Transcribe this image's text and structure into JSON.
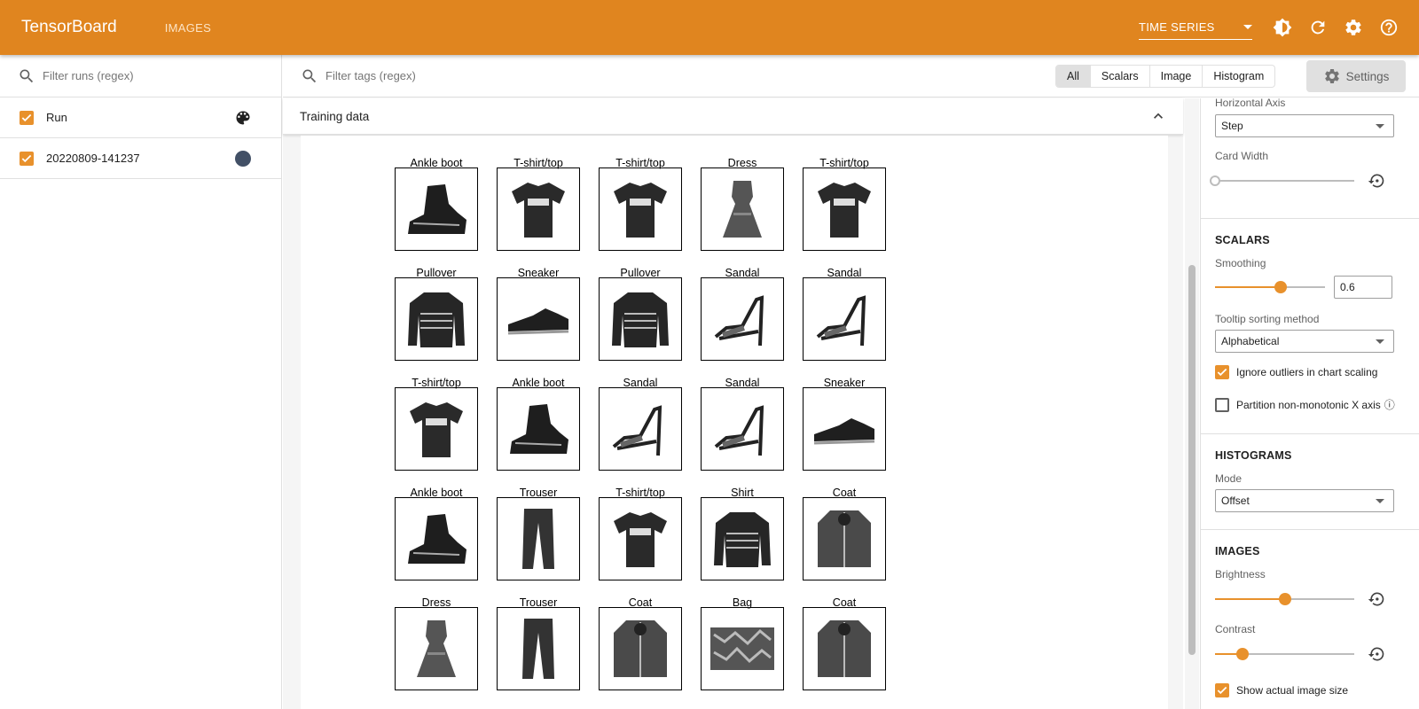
{
  "app": {
    "title": "TensorBoard",
    "nav_label": "IMAGES",
    "mode_selector": "TIME SERIES"
  },
  "runs": {
    "filter_placeholder": "Filter runs (regex)",
    "header_label": "Run",
    "items": [
      {
        "label": "20220809-141237",
        "color": "#425066",
        "checked": true
      }
    ]
  },
  "main": {
    "filter_placeholder": "Filter tags (regex)",
    "type_filters": [
      "All",
      "Scalars",
      "Image",
      "Histogram"
    ],
    "active_filter": "All",
    "settings_button": "Settings"
  },
  "card": {
    "title": "Training data",
    "images": [
      {
        "label": "Ankle boot",
        "icon": "boot-icon"
      },
      {
        "label": "T-shirt/top",
        "icon": "tshirt-icon"
      },
      {
        "label": "T-shirt/top",
        "icon": "tshirt-icon"
      },
      {
        "label": "Dress",
        "icon": "dress-icon"
      },
      {
        "label": "T-shirt/top",
        "icon": "tshirt-icon"
      },
      {
        "label": "Pullover",
        "icon": "pullover-icon"
      },
      {
        "label": "Sneaker",
        "icon": "sneaker-icon"
      },
      {
        "label": "Pullover",
        "icon": "pullover-icon"
      },
      {
        "label": "Sandal",
        "icon": "sandal-icon"
      },
      {
        "label": "Sandal",
        "icon": "sandal-icon"
      },
      {
        "label": "T-shirt/top",
        "icon": "tshirt-icon"
      },
      {
        "label": "Ankle boot",
        "icon": "boot-icon"
      },
      {
        "label": "Sandal",
        "icon": "sandal-icon"
      },
      {
        "label": "Sandal",
        "icon": "sandal-icon"
      },
      {
        "label": "Sneaker",
        "icon": "sneaker-icon"
      },
      {
        "label": "Ankle boot",
        "icon": "boot-icon"
      },
      {
        "label": "Trouser",
        "icon": "trouser-icon"
      },
      {
        "label": "T-shirt/top",
        "icon": "tshirt-icon"
      },
      {
        "label": "Shirt",
        "icon": "pullover-icon"
      },
      {
        "label": "Coat",
        "icon": "coat-icon"
      },
      {
        "label": "Dress",
        "icon": "dress-icon"
      },
      {
        "label": "Trouser",
        "icon": "trouser-icon"
      },
      {
        "label": "Coat",
        "icon": "coat-icon"
      },
      {
        "label": "Bag",
        "icon": "bag-icon"
      },
      {
        "label": "Coat",
        "icon": "coat-icon"
      }
    ]
  },
  "settings": {
    "general": {
      "horizontal_axis_label": "Horizontal Axis",
      "horizontal_axis_value": "Step",
      "card_width_label": "Card Width",
      "card_width_level": 0
    },
    "scalars": {
      "title": "SCALARS",
      "smoothing_label": "Smoothing",
      "smoothing_value": "0.6",
      "smoothing_level": 0.6,
      "tooltip_label": "Tooltip sorting method",
      "tooltip_value": "Alphabetical",
      "ignore_outliers_label": "Ignore outliers in chart scaling",
      "ignore_outliers": true,
      "partition_label": "Partition non-monotonic X axis",
      "partition": false
    },
    "histograms": {
      "title": "HISTOGRAMS",
      "mode_label": "Mode",
      "mode_value": "Offset"
    },
    "images": {
      "title": "IMAGES",
      "brightness_label": "Brightness",
      "brightness_level": 0.5,
      "contrast_label": "Contrast",
      "contrast_level": 0.2,
      "show_actual_label": "Show actual image size",
      "show_actual": true
    }
  },
  "colors": {
    "accent": "#e0851f",
    "checkbox": "#e8912c"
  }
}
